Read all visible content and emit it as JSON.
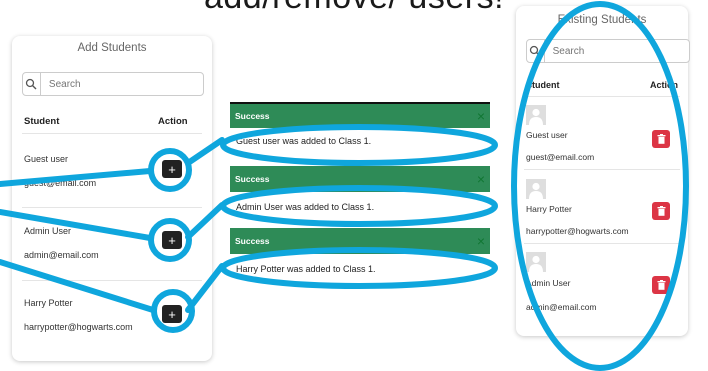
{
  "heading": "add/remove/ users!",
  "add_panel": {
    "title": "Add Students",
    "search_placeholder": "Search",
    "col_student": "Student",
    "col_action": "Action",
    "plus_symbol": "+",
    "rows": [
      {
        "name": "Guest user",
        "email": "guest@email.com"
      },
      {
        "name": "Admin User",
        "email": "admin@email.com"
      },
      {
        "name": "Harry Potter",
        "email": "harrypotter@hogwarts.com"
      }
    ]
  },
  "toasts": [
    {
      "header": "Success",
      "message": "Guest user was added to Class 1."
    },
    {
      "header": "Success",
      "message": "Admin User was added to Class 1."
    },
    {
      "header": "Success",
      "message": "Harry Potter was added to Class 1."
    }
  ],
  "close_symbol": "×",
  "existing_panel": {
    "title": "Existing Students",
    "search_placeholder": "Search",
    "col_student": "Student",
    "col_action": "Action",
    "rows": [
      {
        "name": "Guest user",
        "email": "guest@email.com"
      },
      {
        "name": "Harry Potter",
        "email": "harrypotter@hogwarts.com"
      },
      {
        "name": "Admin User",
        "email": "admin@email.com"
      }
    ]
  },
  "colors": {
    "annotation": "#0fa6dd",
    "success": "#2e8b57",
    "danger": "#dc3545"
  },
  "icons": [
    "search-icon",
    "plus-icon",
    "close-icon",
    "trash-icon",
    "avatar-icon"
  ]
}
